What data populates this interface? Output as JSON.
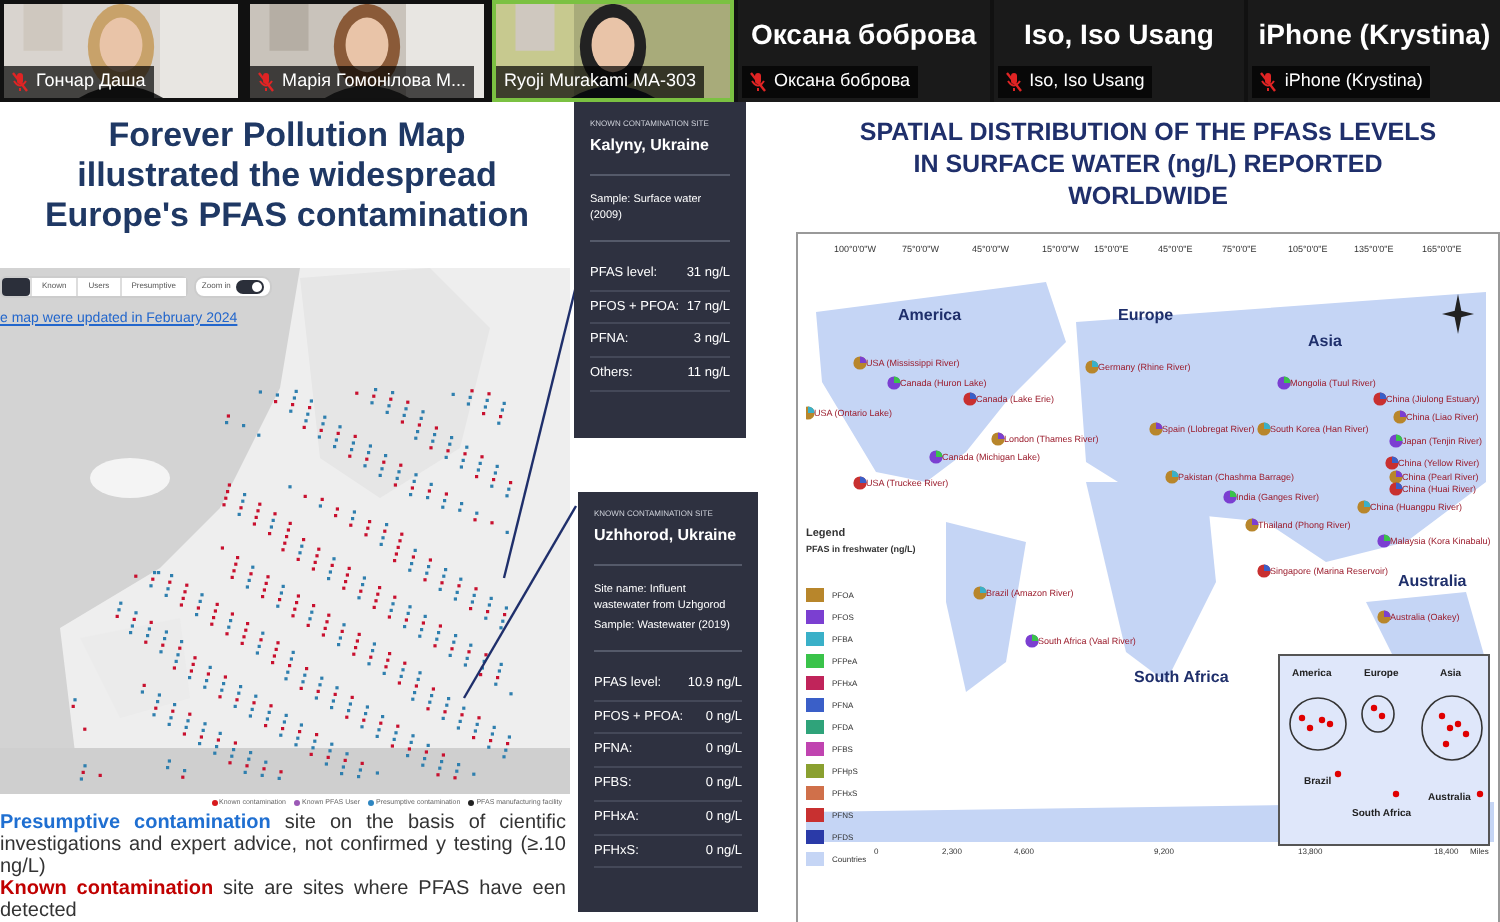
{
  "participants": [
    {
      "kind": "video",
      "name": "Гончар Даша",
      "muted": true,
      "speaking": false
    },
    {
      "kind": "video",
      "name": "Марія Гомонілова M...",
      "muted": true,
      "speaking": false
    },
    {
      "kind": "video",
      "name": "Ryoji Murakami MA-303",
      "muted": false,
      "speaking": true
    },
    {
      "kind": "name",
      "title": "Оксана боброва",
      "name": "Оксана боброва",
      "muted": true,
      "speaking": false
    },
    {
      "kind": "name",
      "title": "Iso, Iso Usang",
      "name": "Iso, Iso Usang",
      "muted": true,
      "speaking": false
    },
    {
      "kind": "name",
      "title": "iPhone (Krystina)",
      "name": "iPhone (Krystina)",
      "muted": true,
      "speaking": false
    }
  ],
  "left_panel": {
    "title_lines": [
      "Forever Pollution Map",
      "illustrated the widespread",
      "Europe's PFAS contamination"
    ],
    "map_tabs": [
      {
        "label": "Known",
        "selected": false
      },
      {
        "label": "Users",
        "selected": false
      },
      {
        "label": "Presumptive",
        "selected": false
      }
    ],
    "zoom_toggle": {
      "label": "Zoom in",
      "on": true
    },
    "update_link": "e map were updated in February 2024",
    "legend": [
      {
        "label": "Known contamination",
        "color": "#d7191c"
      },
      {
        "label": "Known PFAS User",
        "color": "#9b59b6"
      },
      {
        "label": "Presumptive contamination",
        "color": "#2e86c1"
      },
      {
        "label": "PFAS manufacturing facility",
        "color": "#222222"
      }
    ],
    "notes": [
      {
        "highlight": "Presumptive contamination",
        "color": "#1f6fd1",
        "text": " site on the basis of cientific investigations and expert advice, not confirmed y testing (≥.10 ng/L)"
      },
      {
        "highlight": "Known contamination",
        "color": "#c00000",
        "text": " site are sites where PFAS have een detected"
      }
    ]
  },
  "tooltips": [
    {
      "kicker": "KNOWN CONTAMINATION SITE",
      "place": "Kalyny, Ukraine",
      "details": [
        "Sample: Surface water (2009)"
      ],
      "rows": [
        {
          "label": "PFAS level:",
          "value": "31 ng/L"
        },
        {
          "label": "PFOS + PFOA:",
          "value": "17 ng/L"
        },
        {
          "label": "PFNA:",
          "value": "3 ng/L"
        },
        {
          "label": "Others:",
          "value": "11 ng/L"
        }
      ]
    },
    {
      "kicker": "KNOWN CONTAMINATION SITE",
      "place": "Uzhhorod, Ukraine",
      "details": [
        "Site name: Influent wastewater from Uzhgorod",
        "Sample: Wastewater (2019)"
      ],
      "rows": [
        {
          "label": "PFAS level:",
          "value": "10.9 ng/L"
        },
        {
          "label": "PFOS + PFOA:",
          "value": "0 ng/L"
        },
        {
          "label": "PFNA:",
          "value": "0 ng/L"
        },
        {
          "label": "PFBS:",
          "value": "0 ng/L"
        },
        {
          "label": "PFHxA:",
          "value": "0 ng/L"
        },
        {
          "label": "PFHxS:",
          "value": "0 ng/L"
        }
      ]
    }
  ],
  "right_panel": {
    "title_lines": [
      "SPATIAL DISTRIBUTION OF THE PFASs LEVELS",
      "IN SURFACE WATER (ng/L) REPORTED",
      "WORLDWIDE"
    ],
    "map": {
      "ticks": [
        "100°0'0\"W",
        "75°0'0\"W",
        "45°0'0\"W",
        "15°0'0\"W",
        "15°0'0\"E",
        "45°0'0\"E",
        "75°0'0\"E",
        "105°0'0\"E",
        "135°0'0\"E",
        "165°0'0\"E"
      ],
      "regions": [
        "America",
        "Europe",
        "Asia",
        "Australia",
        "South Africa"
      ],
      "sites": [
        "USA (Mississippi River)",
        "Canada (Huron Lake)",
        "Canada (Lake Erie)",
        "USA (Ontario Lake)",
        "London (Thames River)",
        "Canada (Michigan Lake)",
        "USA (Truckee River)",
        "Germany (Rhine River)",
        "Spain (Llobregat River)",
        "Mongolia (Tuul River)",
        "China (Jiulong Estuary)",
        "South Korea (Han River)",
        "China (Liao River)",
        "Japan (Tenjin River)",
        "China (Yellow River)",
        "Pakistan (Chashma Barrage)",
        "China (Pearl River)",
        "India (Ganges River)",
        "China (Huai River)",
        "China (Huangpu River)",
        "Thailand (Phong River)",
        "Malaysia (Kora Kinabalu)",
        "Singapore (Marina Reservoir)",
        "Brazil (Amazon River)",
        "Australia (Oakey)",
        "South Africa (Vaal River)"
      ],
      "legend_title": "Legend",
      "legend_subtitle": "PFAS in freshwater (ng/L)",
      "legend": [
        {
          "label": "PFOA",
          "color": "#b8862b"
        },
        {
          "label": "PFOS",
          "color": "#7b3fd1"
        },
        {
          "label": "PFBA",
          "color": "#3ab0c8"
        },
        {
          "label": "PFPeA",
          "color": "#3ac34a"
        },
        {
          "label": "PFHxA",
          "color": "#c0245a"
        },
        {
          "label": "PFNA",
          "color": "#3a5fc8"
        },
        {
          "label": "PFDA",
          "color": "#2fa37a"
        },
        {
          "label": "PFBS",
          "color": "#c044b0"
        },
        {
          "label": "PFHpS",
          "color": "#8aa030"
        },
        {
          "label": "PFHxS",
          "color": "#d0704a"
        },
        {
          "label": "PFNS",
          "color": "#c83030"
        },
        {
          "label": "PFDS",
          "color": "#2a3aa8"
        },
        {
          "label": "Countries",
          "color": "#c5d5f5"
        }
      ],
      "inset_labels": [
        "America",
        "Europe",
        "Asia",
        "Brazil",
        "South Africa",
        "Australia"
      ],
      "scale": [
        "0",
        "2,300",
        "4,600",
        "9,200",
        "13,800",
        "18,400",
        "Miles"
      ]
    }
  }
}
